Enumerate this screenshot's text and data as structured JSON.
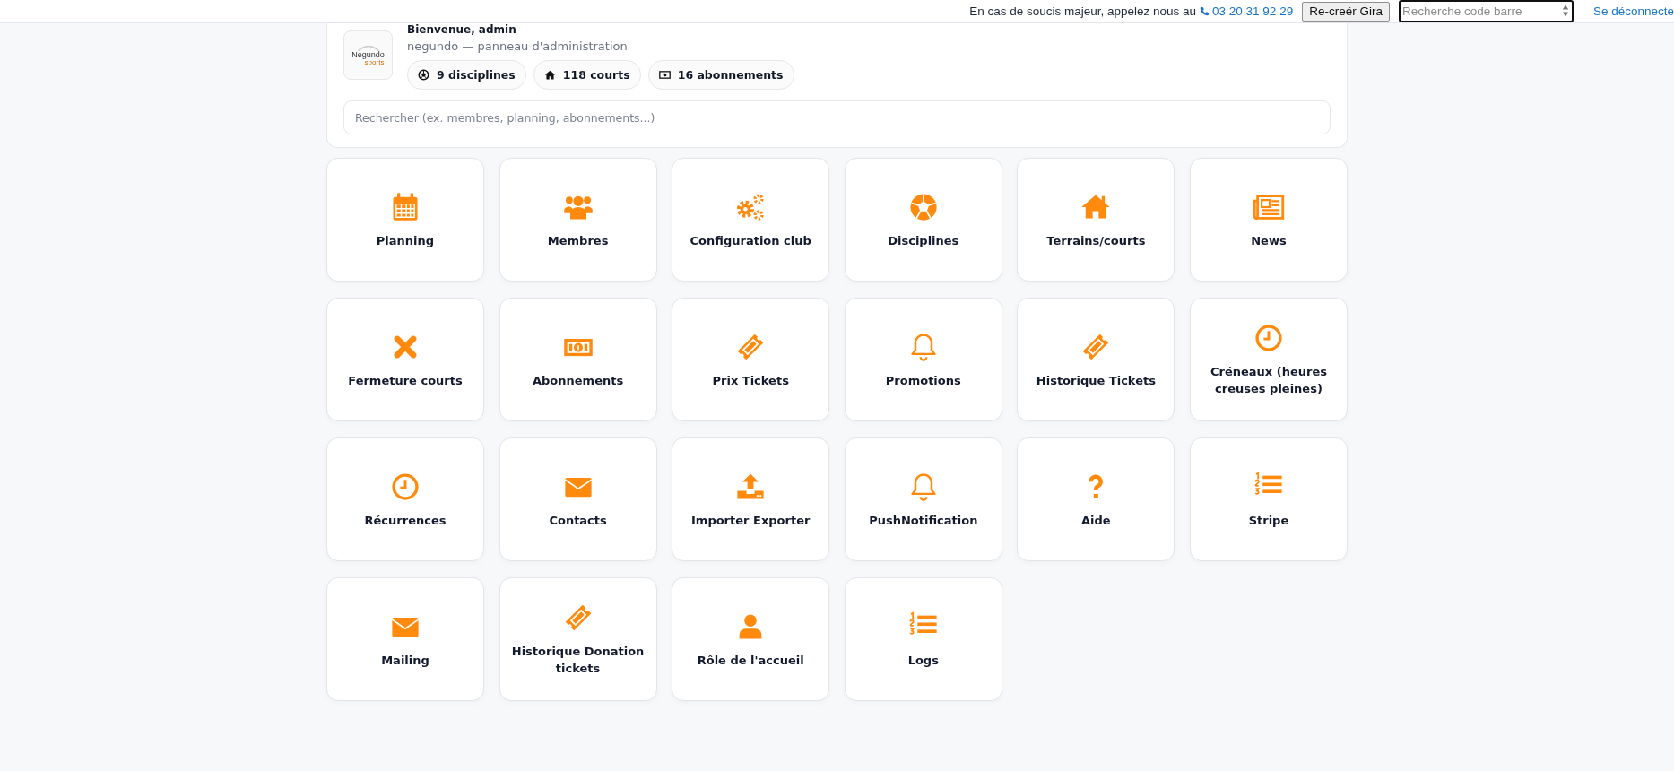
{
  "top_bar": {
    "notice": "En cas de soucis majeur, appelez nous au",
    "phone": "03 20 31 92 29",
    "recreate_button": "Re-creér Gira",
    "barcode_search": {
      "placeholder": "Recherche code barre"
    },
    "logout": "Se déconnecte"
  },
  "header": {
    "logo": {
      "line_1": "Negundo",
      "line_2": "sports"
    },
    "title": "Bienvenue, admin",
    "subtitle": "negundo — panneau d'administration",
    "stats": [
      {
        "label": "9 disciplines"
      },
      {
        "label": "118 courts"
      },
      {
        "label": "16 abonnements"
      }
    ],
    "search": {
      "placeholder": "Rechercher (ex. membres, planning, abonnements...)"
    }
  },
  "tiles": [
    {
      "label": "Planning"
    },
    {
      "label": "Membres"
    },
    {
      "label": "Configuration club"
    },
    {
      "label": "Disciplines"
    },
    {
      "label": "Terrains/courts"
    },
    {
      "label": "News"
    },
    {
      "label": "Fermeture courts"
    },
    {
      "label": "Abonnements"
    },
    {
      "label": "Prix Tickets"
    },
    {
      "label": "Promotions"
    },
    {
      "label": "Historique Tickets"
    },
    {
      "label": "Créneaux (heures creuses pleines)"
    },
    {
      "label": "Récurrences"
    },
    {
      "label": "Contacts"
    },
    {
      "label": "Importer Exporter"
    },
    {
      "label": "PushNotification"
    },
    {
      "label": "Aide"
    },
    {
      "label": "Stripe"
    },
    {
      "label": "Mailing"
    },
    {
      "label": "Historique Donation tickets"
    },
    {
      "label": "Rôle de l'accueil"
    },
    {
      "label": "Logs"
    }
  ]
}
